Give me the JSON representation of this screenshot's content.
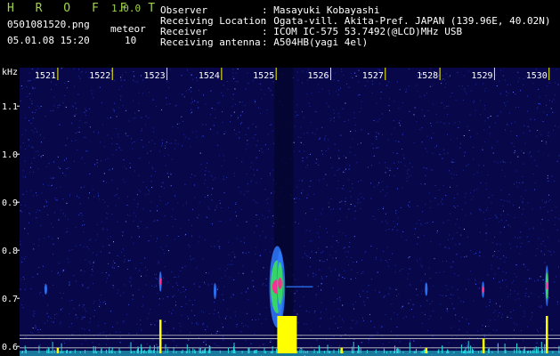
{
  "header": {
    "app_name": "H R O F F T",
    "version": "1.0.0",
    "filename": "0501081520.png",
    "datetime": "05.01.08 15:20",
    "meteor_label": "meteor",
    "meteor_count": "10",
    "info": [
      {
        "label": "Observer",
        "value": ": Masayuki Kobayashi"
      },
      {
        "label": "Receiving Location",
        "value": ": Ogata-vill. Akita-Pref. JAPAN (139.96E, 40.02N)"
      },
      {
        "label": "Receiver",
        "value": ": ICOM IC-575 53.7492(@LCD)MHz USB"
      },
      {
        "label": "Receiving antenna",
        "value": ": A504HB(yagi 4el)"
      }
    ]
  },
  "colors": {
    "background": "#000000",
    "plot_background": "#07074a",
    "title_green": "#9fd34a",
    "echo_core": "#ff2f8f",
    "echo_green": "#38e05a",
    "echo_blue": "#2f7bff",
    "signal_yellow": "#ffff00",
    "noise_cyan": "#28d6e0",
    "time_tick": "#ffff00",
    "ref_line": "#c8c8c8"
  },
  "chart_data": {
    "type": "heatmap",
    "xlabel": "",
    "ylabel": "kHz",
    "x_ticks": [
      "1521",
      "1522",
      "1523",
      "1524",
      "1525",
      "1526",
      "1527",
      "1528",
      "1529",
      "1530"
    ],
    "x_range": [
      1520.3,
      1530.2
    ],
    "y_ticks": [
      {
        "value": 1.1,
        "label": "1.1"
      },
      {
        "value": 1.0,
        "label": "1.0"
      },
      {
        "value": 0.9,
        "label": "0.9"
      },
      {
        "value": 0.8,
        "label": "0.8"
      },
      {
        "value": 0.7,
        "label": "0.7"
      },
      {
        "value": 0.6,
        "label": "0.6"
      }
    ],
    "y_range": [
      0.58,
      1.18
    ],
    "reference_lines_khz": [
      0.623,
      0.616,
      0.597
    ],
    "echoes": [
      {
        "time": 1525.02,
        "freq": 0.724,
        "peak": 1.0,
        "spread": 0.05,
        "width": 0.12
      },
      {
        "time": 1525.07,
        "freq": 0.731,
        "peak": 0.9,
        "spread": 0.04,
        "width": 0.05
      },
      {
        "time": 1522.88,
        "freq": 0.735,
        "peak": 0.75,
        "spread": 0.015,
        "width": 0.02
      },
      {
        "time": 1523.88,
        "freq": 0.715,
        "peak": 0.5,
        "spread": 0.012,
        "width": 0.02
      },
      {
        "time": 1520.78,
        "freq": 0.719,
        "peak": 0.35,
        "spread": 0.008,
        "width": 0.02
      },
      {
        "time": 1527.75,
        "freq": 0.719,
        "peak": 0.4,
        "spread": 0.01,
        "width": 0.02
      },
      {
        "time": 1528.79,
        "freq": 0.718,
        "peak": 0.55,
        "spread": 0.012,
        "width": 0.02
      },
      {
        "time": 1529.96,
        "freq": 0.726,
        "peak": 0.95,
        "spread": 0.025,
        "width": 0.02
      }
    ],
    "signal_level": [
      {
        "time": 1522.88,
        "level": 0.9
      },
      {
        "time": 1525.02,
        "level": 1.0
      },
      {
        "time": 1525.2,
        "level": 0.55
      },
      {
        "time": 1525.35,
        "level": 0.3
      },
      {
        "time": 1529.96,
        "level": 1.0
      },
      {
        "time": 1528.8,
        "level": 0.4
      },
      {
        "time": 1526.2,
        "level": 0.15
      },
      {
        "time": 1521.0,
        "level": 0.15
      },
      {
        "time": 1527.75,
        "level": 0.15
      }
    ]
  }
}
